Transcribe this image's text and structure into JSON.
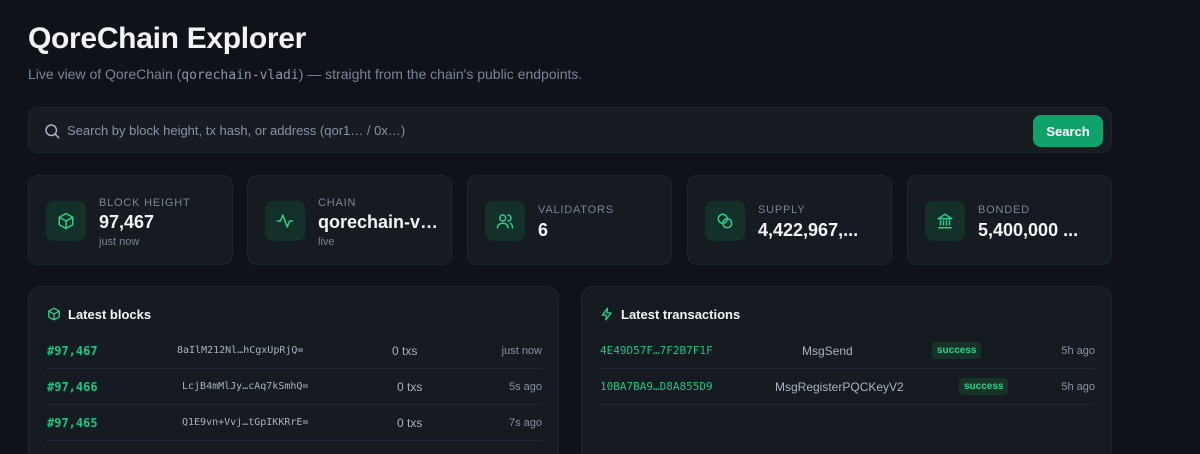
{
  "header": {
    "title": "QoreChain Explorer",
    "subtitle_prefix": "Live view of QoreChain (",
    "chain_id": "qorechain-vladi",
    "subtitle_suffix": ") — straight from the chain's public endpoints."
  },
  "search": {
    "placeholder": "Search by block height, tx hash, or address (qor1… / 0x…)",
    "value": "",
    "button_label": "Search"
  },
  "stats": [
    {
      "icon": "cube-icon",
      "label": "Block height",
      "value": "97,467",
      "sub": "just now"
    },
    {
      "icon": "activity-icon",
      "label": "Chain",
      "value": "qorechain-vladi",
      "sub": "live"
    },
    {
      "icon": "users-icon",
      "label": "Validators",
      "value": "6"
    },
    {
      "icon": "coins-icon",
      "label": "Supply",
      "value": "4,422,967,..."
    },
    {
      "icon": "bank-icon",
      "label": "Bonded",
      "value": "5,400,000 ..."
    }
  ],
  "latest_blocks": {
    "title": "Latest blocks",
    "rows": [
      {
        "height": "#97,467",
        "hash": "8aIlM212Nl…hCgxUpRjQ=",
        "txs": "0 txs",
        "time": "just now"
      },
      {
        "height": "#97,466",
        "hash": "LcjB4mMlJy…cAq7kSmhQ=",
        "txs": "0 txs",
        "time": "5s ago"
      },
      {
        "height": "#97,465",
        "hash": "Q1E9vn+Vvj…tGpIKKRrE=",
        "txs": "0 txs",
        "time": "7s ago"
      }
    ]
  },
  "latest_transactions": {
    "title": "Latest transactions",
    "rows": [
      {
        "hash": "4E49D57F…7F2B7F1F",
        "type": "MsgSend",
        "status": "success",
        "time": "5h ago"
      },
      {
        "hash": "10BA7BA9…D8A855D9",
        "type": "MsgRegisterPQCKeyV2",
        "status": "success",
        "time": "5h ago"
      }
    ]
  },
  "colors": {
    "background": "#0f1319",
    "card": "#161b22",
    "accent": "#10a26b",
    "accent_text": "#19c487"
  }
}
